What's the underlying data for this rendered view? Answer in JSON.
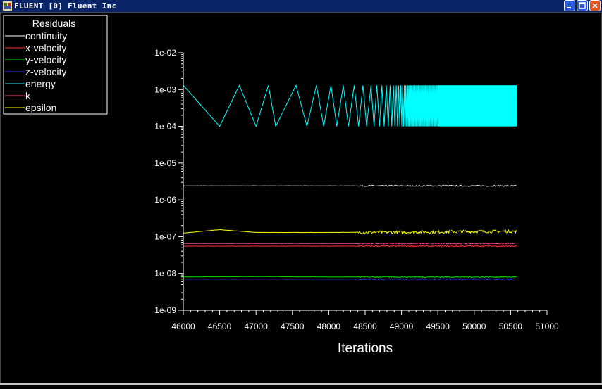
{
  "window": {
    "title": "FLUENT [0] Fluent Inc",
    "icon": "fluent-app-icon",
    "controls": [
      "minimize-icon",
      "maximize-icon",
      "close-icon"
    ]
  },
  "colors": {
    "continuity": "#ffffff",
    "x-velocity": "#ff3030",
    "y-velocity": "#00dd00",
    "z-velocity": "#3030ff",
    "energy": "#00ffff",
    "k": "#ff4080",
    "epsilon": "#ffff00"
  },
  "chart_data": {
    "type": "line",
    "title": "",
    "xlabel": "Iterations",
    "ylabel": "",
    "xlim": [
      46000,
      51000
    ],
    "ylim": [
      1e-09,
      0.01
    ],
    "yscale": "log",
    "xticks": [
      46000,
      46500,
      47000,
      47500,
      48000,
      48500,
      49000,
      49500,
      50000,
      50500,
      51000
    ],
    "yticks": [
      "1e-09",
      "1e-08",
      "1e-07",
      "1e-06",
      "1e-05",
      "1e-04",
      "1e-03",
      "1e-02"
    ],
    "grid": false,
    "legend": {
      "title": "Residuals",
      "placement": "top-left",
      "entries": [
        "continuity",
        "x-velocity",
        "y-velocity",
        "z-velocity",
        "energy",
        "k",
        "epsilon"
      ]
    },
    "series": [
      {
        "name": "energy",
        "oscillation": {
          "x_start": 46000,
          "x_end": 50580,
          "peaks": [
            46000,
            46770,
            47170,
            47550,
            47830,
            48030,
            48200,
            48350,
            48470,
            48580
          ],
          "troughs": [
            46500,
            47000,
            47270,
            47700,
            47930,
            48110,
            48270,
            48410,
            48520
          ],
          "peak_value": 0.0013,
          "trough_value": 0.0001,
          "band_from": 48600,
          "dense_from": 49500
        }
      },
      {
        "name": "continuity",
        "x": [
          46000,
          47000,
          48000,
          49000,
          50000,
          50580
        ],
        "y": [
          2.4e-06,
          2.4e-06,
          2.4e-06,
          2.4e-06,
          2.4e-06,
          2.4e-06
        ]
      },
      {
        "name": "epsilon",
        "x": [
          46000,
          46500,
          47000,
          47500,
          48000,
          48500,
          49000,
          49500,
          50000,
          50580
        ],
        "y": [
          1.25e-07,
          1.55e-07,
          1.3e-07,
          1.3e-07,
          1.3e-07,
          1.32e-07,
          1.32e-07,
          1.35e-07,
          1.38e-07,
          1.4e-07
        ]
      },
      {
        "name": "k",
        "x": [
          46000,
          47000,
          48000,
          49000,
          50000,
          50580
        ],
        "y": [
          6.5e-08,
          6.5e-08,
          6.5e-08,
          6.5e-08,
          6.5e-08,
          6.5e-08
        ]
      },
      {
        "name": "x-velocity",
        "x": [
          46000,
          47000,
          48000,
          49000,
          50000,
          50580
        ],
        "y": [
          5.5e-08,
          5.5e-08,
          5.5e-08,
          5.5e-08,
          5.5e-08,
          5.5e-08
        ]
      },
      {
        "name": "y-velocity",
        "x": [
          46000,
          47000,
          48000,
          49000,
          50000,
          50580
        ],
        "y": [
          8e-09,
          8.2e-09,
          8e-09,
          8e-09,
          8e-09,
          8e-09
        ]
      },
      {
        "name": "z-velocity",
        "x": [
          46000,
          47000,
          48000,
          49000,
          50000,
          50580
        ],
        "y": [
          7e-09,
          7e-09,
          7e-09,
          7e-09,
          7e-09,
          7e-09
        ]
      }
    ]
  }
}
